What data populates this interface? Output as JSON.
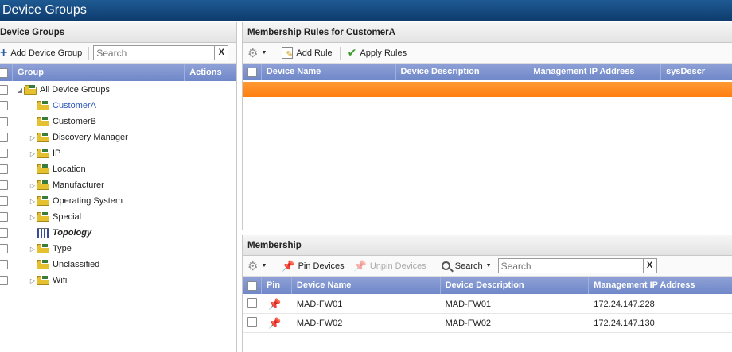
{
  "app": {
    "title": "Device Groups"
  },
  "left": {
    "title": "Device Groups",
    "add_label": "Add Device Group",
    "search_placeholder": "Search",
    "clear_glyph": "X",
    "columns": {
      "group": "Group",
      "actions": "Actions"
    },
    "tree": [
      {
        "label": "All Device Groups",
        "expanded": true
      },
      {
        "label": "CustomerA",
        "selected": true
      },
      {
        "label": "CustomerB"
      },
      {
        "label": "Discovery Manager",
        "collapsed": true
      },
      {
        "label": "IP",
        "collapsed": true
      },
      {
        "label": "Location"
      },
      {
        "label": "Manufacturer",
        "collapsed": true
      },
      {
        "label": "Operating System",
        "collapsed": true
      },
      {
        "label": "Special",
        "collapsed": true
      },
      {
        "label": "Topology",
        "italic": true
      },
      {
        "label": "Type",
        "collapsed": true
      },
      {
        "label": "Unclassified"
      },
      {
        "label": "Wifi",
        "collapsed": true
      }
    ]
  },
  "rules": {
    "title": "Membership Rules for CustomerA",
    "add_rule": "Add Rule",
    "apply_rules": "Apply Rules",
    "columns": {
      "device_name": "Device Name",
      "device_description": "Device Description",
      "mgmt_ip": "Management IP Address",
      "sysdescr": "sysDescr"
    }
  },
  "membership": {
    "title": "Membership",
    "pin": "Pin Devices",
    "unpin": "Unpin Devices",
    "search_label": "Search",
    "search_placeholder": "Search",
    "clear_glyph": "X",
    "columns": {
      "pin": "Pin",
      "device_name": "Device Name",
      "device_description": "Device Description",
      "mgmt_ip": "Management IP Address"
    },
    "rows": [
      {
        "name": "MAD-FW01",
        "description": "MAD-FW01",
        "ip": "172.24.147.228"
      },
      {
        "name": "MAD-FW02",
        "description": "MAD-FW02",
        "ip": "172.24.147.130"
      }
    ]
  },
  "colors": {
    "accent_orange": "#ff8a1c",
    "header_blue": "#7a90cc",
    "titlebar": "#15497f",
    "selected_text": "#2a56b8"
  }
}
